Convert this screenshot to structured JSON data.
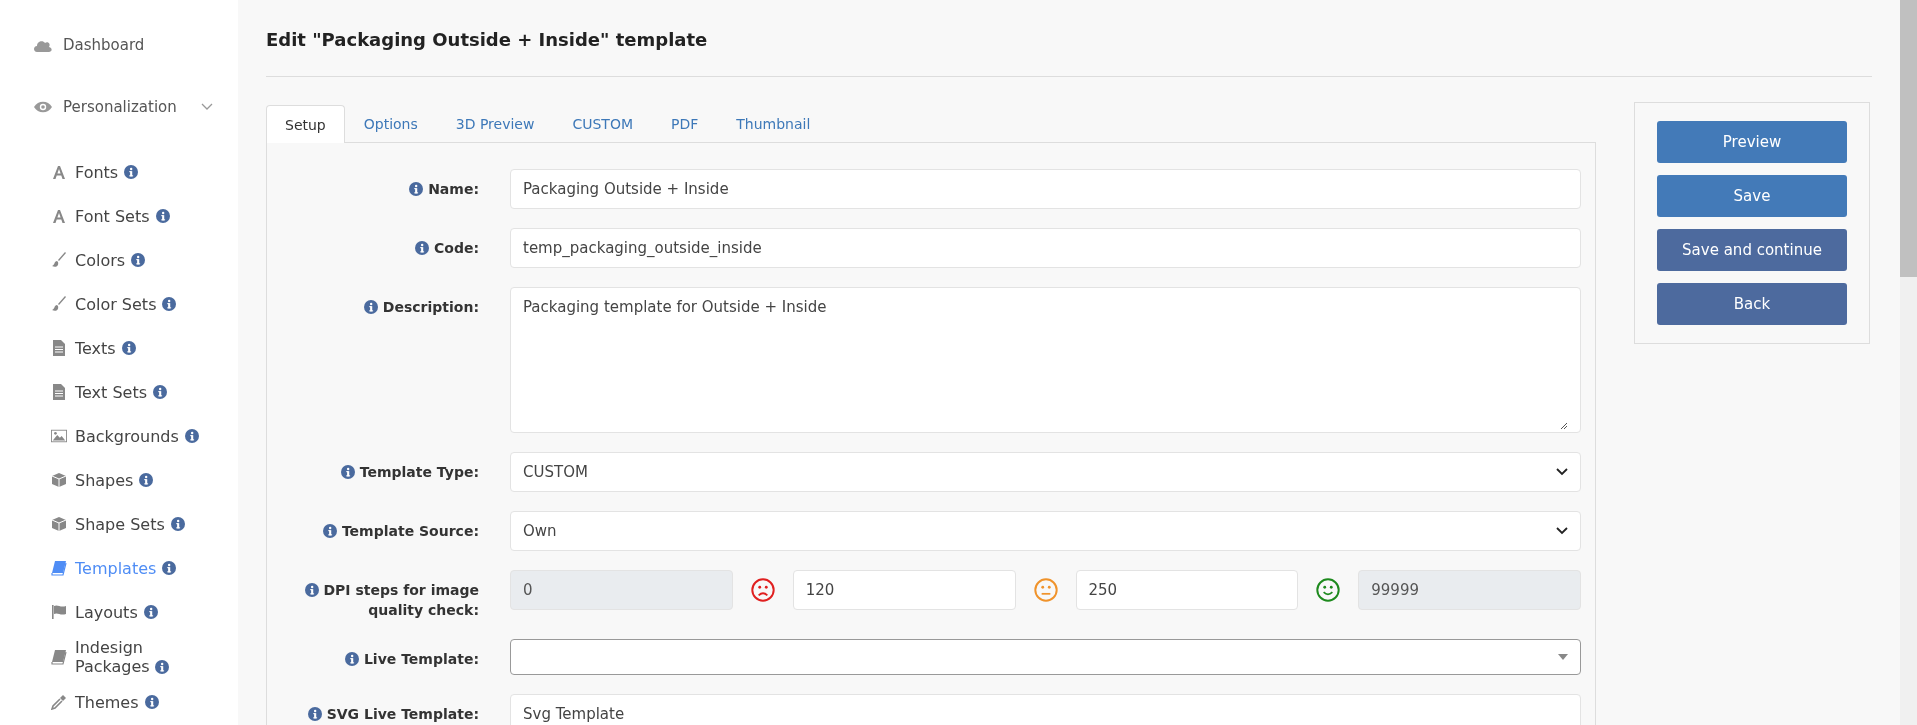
{
  "sidebar": {
    "items": [
      {
        "label": "Dashboard",
        "selected": false
      },
      {
        "label": "Personalization",
        "selected": false,
        "expanded": true,
        "children": [
          {
            "label": "Fonts",
            "selected": false
          },
          {
            "label": "Font Sets",
            "selected": false
          },
          {
            "label": "Colors",
            "selected": false
          },
          {
            "label": "Color Sets",
            "selected": false
          },
          {
            "label": "Texts",
            "selected": false
          },
          {
            "label": "Text Sets",
            "selected": false
          },
          {
            "label": "Backgrounds",
            "selected": false
          },
          {
            "label": "Shapes",
            "selected": false
          },
          {
            "label": "Shape Sets",
            "selected": false
          },
          {
            "label": "Templates",
            "selected": true
          },
          {
            "label": "Layouts",
            "selected": false
          },
          {
            "label": "Indesign Packages",
            "selected": false
          },
          {
            "label": "Themes",
            "selected": false
          }
        ]
      }
    ]
  },
  "page_title": "Edit \"Packaging Outside + Inside\" template",
  "tabs": [
    {
      "label": "Setup",
      "selected": true
    },
    {
      "label": "Options",
      "selected": false
    },
    {
      "label": "3D Preview",
      "selected": false
    },
    {
      "label": "CUSTOM",
      "selected": false
    },
    {
      "label": "PDF",
      "selected": false
    },
    {
      "label": "Thumbnail",
      "selected": false
    }
  ],
  "form": [
    {
      "kind": "text",
      "label": "Name:",
      "value": "Packaging Outside + Inside"
    },
    {
      "kind": "text",
      "label": "Code:",
      "value": "temp_packaging_outside_inside"
    },
    {
      "kind": "textarea",
      "label": "Description:",
      "value": "Packaging template for Outside + Inside"
    },
    {
      "kind": "select",
      "label": "Template Type:",
      "value": "CUSTOM"
    },
    {
      "kind": "select",
      "label": "Template Source:",
      "value": "Own"
    },
    {
      "kind": "dpi",
      "label": "DPI steps for image quality check:",
      "values": [
        {
          "value": "0",
          "disabled": true
        },
        {
          "value": "120",
          "disabled": false
        },
        {
          "value": "250",
          "disabled": false
        },
        {
          "value": "99999",
          "disabled": true
        }
      ]
    },
    {
      "kind": "combo",
      "label": "Live Template:"
    },
    {
      "kind": "text",
      "label": "SVG Live Template:",
      "value": "Svg Template"
    }
  ],
  "actions": [
    {
      "label": "Preview",
      "kind": "primary"
    },
    {
      "label": "Save",
      "kind": "primary"
    },
    {
      "label": "Save and continue",
      "kind": "secondary"
    },
    {
      "label": "Back",
      "kind": "secondary"
    }
  ]
}
